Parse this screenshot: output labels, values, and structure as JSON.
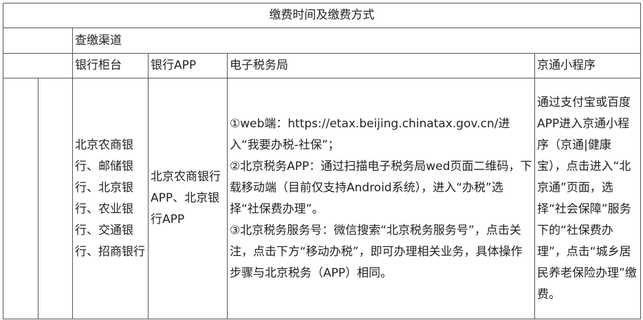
{
  "table": {
    "title": "缴费时间及缴费方式",
    "channel_header": "查缴渠道",
    "columns": [
      "银行柜台",
      "银行APP",
      "电子税务局",
      "京通小程序"
    ],
    "row": {
      "bank_counter": "北京农商银行、邮储银行、北京银行、农业银行、交通银行、招商银行",
      "bank_app": "北京农商银行APP、北京银行APP",
      "etax": [
        "①web端：https://etax.beijing.chinatax.gov.cn/进入“我要办税-社保”；",
        "②北京税务APP：通过扫描电子税务局wed页面二维码，下载移动端（目前仅支持Android系统），进入“办税”选择“社保费办理”。",
        "③北京税务服务号：微信搜索“北京税务服务号”，点击关注，点击下方“移动办税”，即可办理相关业务，具体操作步骤与北京税务（APP）相同。"
      ],
      "jingtong": "通过支付宝或百度APP进入京通小程序（京通|健康宝），点击进入“北京通”页面，选择“社会保障”服务下的“社保费办理”，点击“城乡居民养老保险办理”缴费。"
    }
  }
}
